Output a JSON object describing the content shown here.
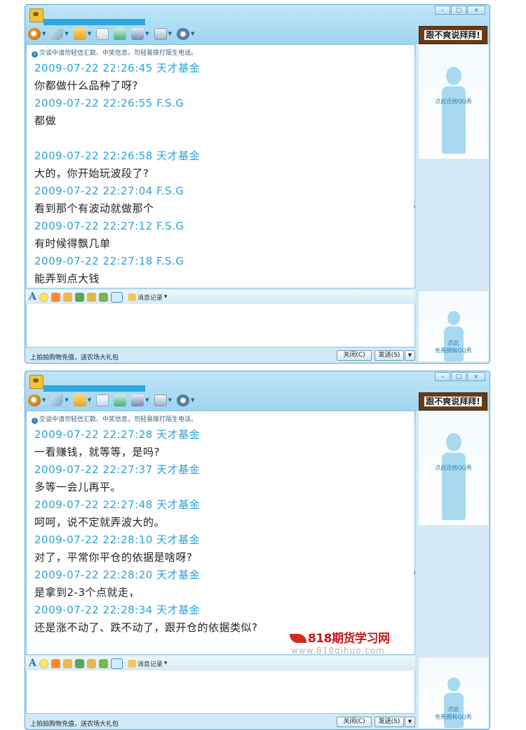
{
  "window_controls": {
    "min": "–",
    "max": "□",
    "close": "×"
  },
  "banner_text": "跟不爽说拜拜!",
  "notice_text": "交谈中请勿轻信汇款、中奖信息，勿轻易拨打陌生电话。",
  "format_bar": {
    "font_label": "A",
    "history_label": "消息记录"
  },
  "status_ad": "上拍拍购物充值，送农场大礼包",
  "buttons": {
    "close": "关闭(C)",
    "send": "发送(S)"
  },
  "side": {
    "top_label": "点此还他QQ秀",
    "bottom_label_1": "点此",
    "bottom_label_2": "免费拥有QQ秀"
  },
  "watermark": {
    "logo": "818期货学习网",
    "url": "www.818qihuo.com"
  },
  "windows": [
    {
      "messages": [
        {
          "kind": "hdr",
          "text": "2009-07-22 22:26:45 天才基金"
        },
        {
          "kind": "txt",
          "text": "你都做什么品种了呀?"
        },
        {
          "kind": "hdr",
          "text": "2009-07-22 22:26:55 F.S.G"
        },
        {
          "kind": "txt",
          "text": "都做"
        },
        {
          "kind": "blank",
          "text": ""
        },
        {
          "kind": "hdr",
          "text": "2009-07-22 22:26:58 天才基金"
        },
        {
          "kind": "txt",
          "text": "大的，你开始玩波段了?"
        },
        {
          "kind": "hdr",
          "text": "2009-07-22 22:27:04 F.S.G"
        },
        {
          "kind": "txt",
          "text": "看到那个有波动就做那个"
        },
        {
          "kind": "hdr",
          "text": "2009-07-22 22:27:12 F.S.G"
        },
        {
          "kind": "txt",
          "text": "有时候得飘几单"
        },
        {
          "kind": "hdr",
          "text": "2009-07-22 22:27:18 F.S.G"
        },
        {
          "kind": "txt",
          "text": "能弄到点大钱"
        }
      ]
    },
    {
      "messages": [
        {
          "kind": "hdr",
          "text": "2009-07-22 22:27:28 天才基金"
        },
        {
          "kind": "txt",
          "text": "一看赚钱，就等等，是吗?"
        },
        {
          "kind": "hdr",
          "text": "2009-07-22 22:27:37 天才基金"
        },
        {
          "kind": "txt",
          "text": "多等一会儿再平。"
        },
        {
          "kind": "hdr",
          "text": "2009-07-22 22:27:48 天才基金"
        },
        {
          "kind": "txt",
          "text": "呵呵，说不定就弄波大的。"
        },
        {
          "kind": "hdr",
          "text": "2009-07-22 22:28:10 天才基金"
        },
        {
          "kind": "txt",
          "text": "对了，平常你平仓的依据是啥呀?"
        },
        {
          "kind": "hdr",
          "text": "2009-07-22 22:28:20 天才基金"
        },
        {
          "kind": "txt",
          "text": "是拿到2-3个点就走，"
        },
        {
          "kind": "hdr",
          "text": "2009-07-22 22:28:34 天才基金"
        },
        {
          "kind": "txt",
          "text": "还是涨不动了、跌不动了，跟开仓的依据类似?"
        }
      ]
    }
  ]
}
